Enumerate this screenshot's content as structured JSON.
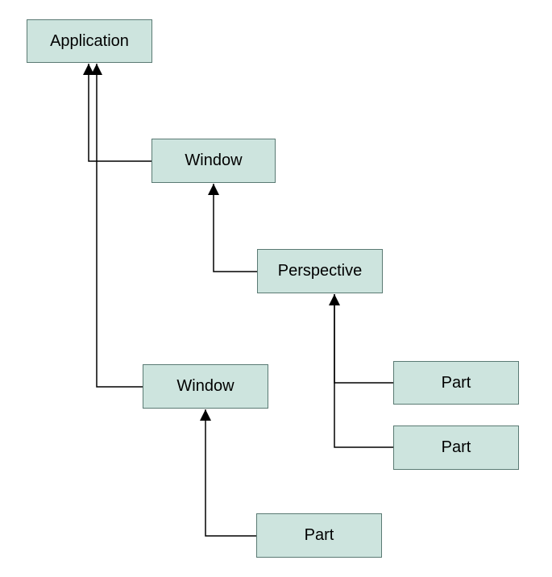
{
  "nodes": {
    "application": {
      "label": "Application"
    },
    "window1": {
      "label": "Window"
    },
    "perspective": {
      "label": "Perspective"
    },
    "window2": {
      "label": "Window"
    },
    "part1": {
      "label": "Part"
    },
    "part2": {
      "label": "Part"
    },
    "part3": {
      "label": "Part"
    }
  },
  "colors": {
    "nodeFill": "#cde4de",
    "nodeBorder": "#5a7a73",
    "arrow": "#000000"
  }
}
